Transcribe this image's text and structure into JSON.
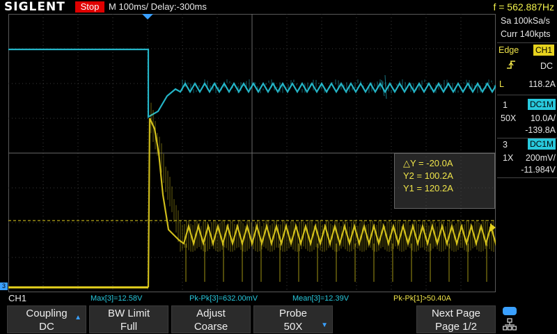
{
  "header": {
    "brand": "SIGLENT",
    "run_state": "Stop",
    "timebase": "M 100ms/  Delay:-300ms",
    "frequency": "f = 562.887Hz"
  },
  "acquisition": {
    "sample_rate": "Sa 100kSa/s",
    "memory_depth": "Curr 140kpts"
  },
  "trigger": {
    "type_label": "Edge",
    "source": "CH1",
    "coupling": "DC",
    "level_label": "L",
    "level": "118.2A"
  },
  "channels": [
    {
      "number": "1",
      "coupling": "DC1M",
      "probe": "50X",
      "scale": "10.0A/",
      "offset": "-139.8A",
      "color": "#28c8dc"
    },
    {
      "number": "3",
      "coupling": "DC1M",
      "probe": "1X",
      "scale": "200mV/",
      "offset": "-11.984V",
      "color": "#e6d21e"
    }
  ],
  "cursor_measure": {
    "delta_y": "△Y = -20.0A",
    "y2": "Y2 = 100.2A",
    "y1": "Y1 = 120.2A"
  },
  "status": {
    "active_channel": "CH1",
    "max3": "Max[3]=12.58V",
    "pkpk3": "Pk-Pk[3]=632.00mV",
    "mean3": "Mean[3]=12.39V",
    "pkpk1": "Pk-Pk[1]>50.40A"
  },
  "menu": {
    "coupling_label": "Coupling",
    "coupling_value": "DC",
    "bw_label": "BW Limit",
    "bw_value": "Full",
    "adjust_label": "Adjust",
    "adjust_value": "Coarse",
    "probe_label": "Probe",
    "probe_value": "50X",
    "next_label": "Next Page",
    "next_value": "Page 1/2"
  },
  "markers": {
    "ch3_marker": "3"
  },
  "colors": {
    "ch1": "#28c8dc",
    "ch3": "#e6d21e",
    "run_stop": "#e00000",
    "grid": "#4a4a4a",
    "accent_blue": "#3aa0ff"
  },
  "icons": [
    "trigger-rising-edge-icon",
    "up-arrow-icon",
    "down-arrow-icon",
    "toggle-icon",
    "network-icon",
    "trigger-position-marker-icon",
    "trigger-level-marker-icon"
  ]
}
